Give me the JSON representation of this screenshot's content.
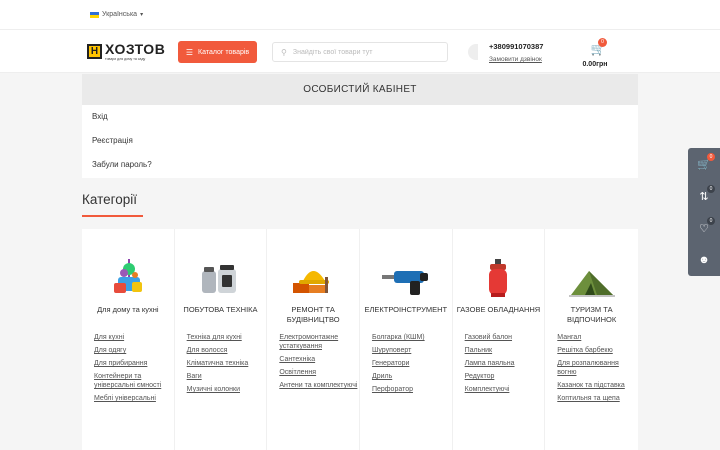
{
  "topbar": {
    "language": "Українська"
  },
  "header": {
    "logo_letter": "Н",
    "logo_name": "ХОЗТОВ",
    "logo_tagline": "товари для дому та саду",
    "catalog_label": "Каталог товарів",
    "search_placeholder": "Знайдіть свої товари тут",
    "phone": "+380991070387",
    "callback": "Замовити дзвінок",
    "cart_count": "0",
    "cart_total": "0.00грн"
  },
  "account": {
    "title": "ОСОБИСТИЙ КАБІНЕТ",
    "links": [
      "Вхід",
      "Реєстрація",
      "Забули пароль?"
    ]
  },
  "categories_heading": "Категорії",
  "categories": [
    {
      "title": "Для дому та кухні",
      "links": [
        "Для кухні",
        "Для одягу",
        "Для прибирання",
        "Контейнери та універсальні ємності",
        "Меблі універсальні"
      ]
    },
    {
      "title": "ПОБУТОВА ТЕХНІКА",
      "links": [
        "Техніка для кухні",
        "Для волосся",
        "Кліматична техніка",
        "Ваги",
        "Музичні колонки"
      ]
    },
    {
      "title": "РЕМОНТ ТА БУДІВНИЦТВО",
      "links": [
        "Електромонтажне устаткування",
        "Сантехніка",
        "Освітлення",
        "Антени та комплектуючі"
      ]
    },
    {
      "title": "ЕЛЕКТРОІНСТРУМЕНТ",
      "links": [
        "Болгарка (КШМ)",
        "Шуруповерт",
        "Генератори",
        "Дриль",
        "Перфоратор"
      ]
    },
    {
      "title": "ГАЗОВЕ ОБЛАДНАННЯ",
      "links": [
        "Газовий балон",
        "Пальник",
        "Лампа паяльна",
        "Редуктор",
        "Комплектуючі"
      ]
    },
    {
      "title": "ТУРИЗМ ТА ВІДПОЧИНОК",
      "links": [
        "Мангал",
        "Решітка барбекю",
        "Для розпалювання вогню",
        "Казанок та підставка",
        "Коптильня та щепа"
      ]
    }
  ],
  "side": {
    "cart_count": "0",
    "compare_count": "0",
    "wishlist_count": "0"
  },
  "colors": {
    "accent": "#f15a3c",
    "side_bar": "#5c6470"
  }
}
